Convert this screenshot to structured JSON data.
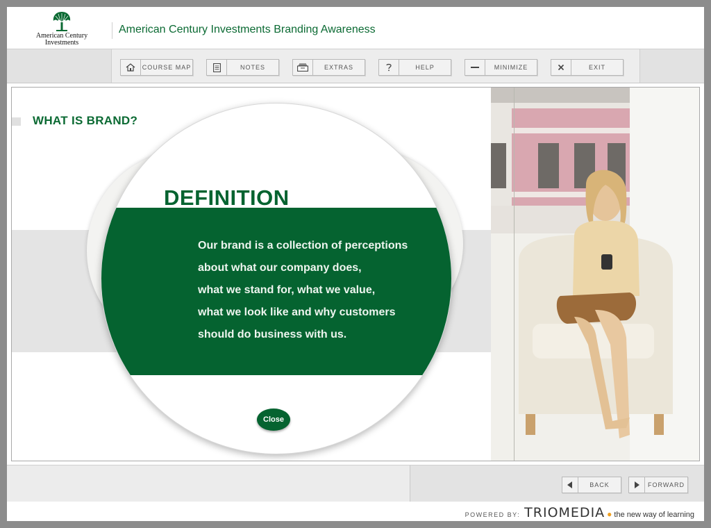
{
  "header": {
    "logo_text_line1": "American Century",
    "logo_text_line2": "Investments",
    "title": "American Century Investments Branding Awareness"
  },
  "toolbar": {
    "buttons": [
      {
        "label": "COURSE MAP",
        "icon": "home-icon"
      },
      {
        "label": "NOTES",
        "icon": "document-icon"
      },
      {
        "label": "EXTRAS",
        "icon": "tray-icon"
      },
      {
        "label": "HELP",
        "icon": "question-icon"
      },
      {
        "label": "MINIMIZE",
        "icon": "minus-icon"
      },
      {
        "label": "EXIT",
        "icon": "close-icon"
      }
    ]
  },
  "content": {
    "section_title": "WHAT IS BRAND?",
    "definition_title": "DEFINITION",
    "definition_lines": [
      "Our brand is a collection of perceptions",
      "about what our company does,",
      "what we stand for, what we value,",
      "what we look like and why customers",
      "should do business with us."
    ],
    "close_label": "Close"
  },
  "navigation": {
    "back_label": "BACK",
    "forward_label": "FORWARD"
  },
  "footer": {
    "powered_by": "POWERED BY:",
    "brand": "TRIOMEDIA",
    "tagline": "the new way of learning"
  },
  "colors": {
    "brand_green": "#056330",
    "title_green": "#0b6a33"
  }
}
